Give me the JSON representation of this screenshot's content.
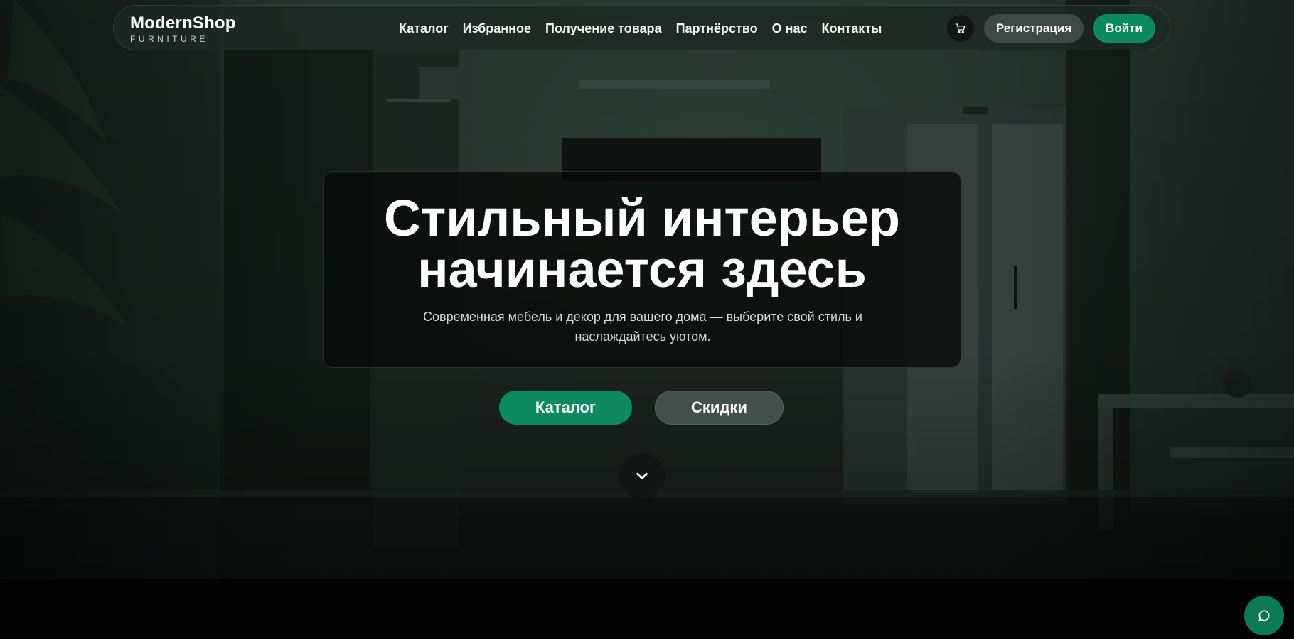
{
  "nav": {
    "logo_main": "ModernShop",
    "logo_sub": "FURNITURE",
    "menu": [
      {
        "label": "Каталог"
      },
      {
        "label": "Избранное"
      },
      {
        "label": "Получение товара"
      },
      {
        "label": "Партнёрство"
      },
      {
        "label": "О нас"
      },
      {
        "label": "Контакты"
      }
    ],
    "cart_icon": "cart-icon",
    "register_label": "Регистрация",
    "login_label": "Войти"
  },
  "hero": {
    "title_line1": "Стильный интерьер",
    "title_line2": "начинается здесь",
    "subtitle_line1": "Современная мебель и декор для вашего дома — выберите свой стиль и",
    "subtitle_line2": "наслаждайтесь уютом.",
    "catalog_label": "Каталог",
    "discounts_label": "Скидки",
    "scroll_icon": "chevron-down-icon"
  },
  "chat": {
    "icon": "chat-icon"
  },
  "colors": {
    "accent": "#0d8a5f",
    "nav_bg": "#1c2823",
    "secondary_button": "#3c4944",
    "footer_band": "#020202"
  }
}
